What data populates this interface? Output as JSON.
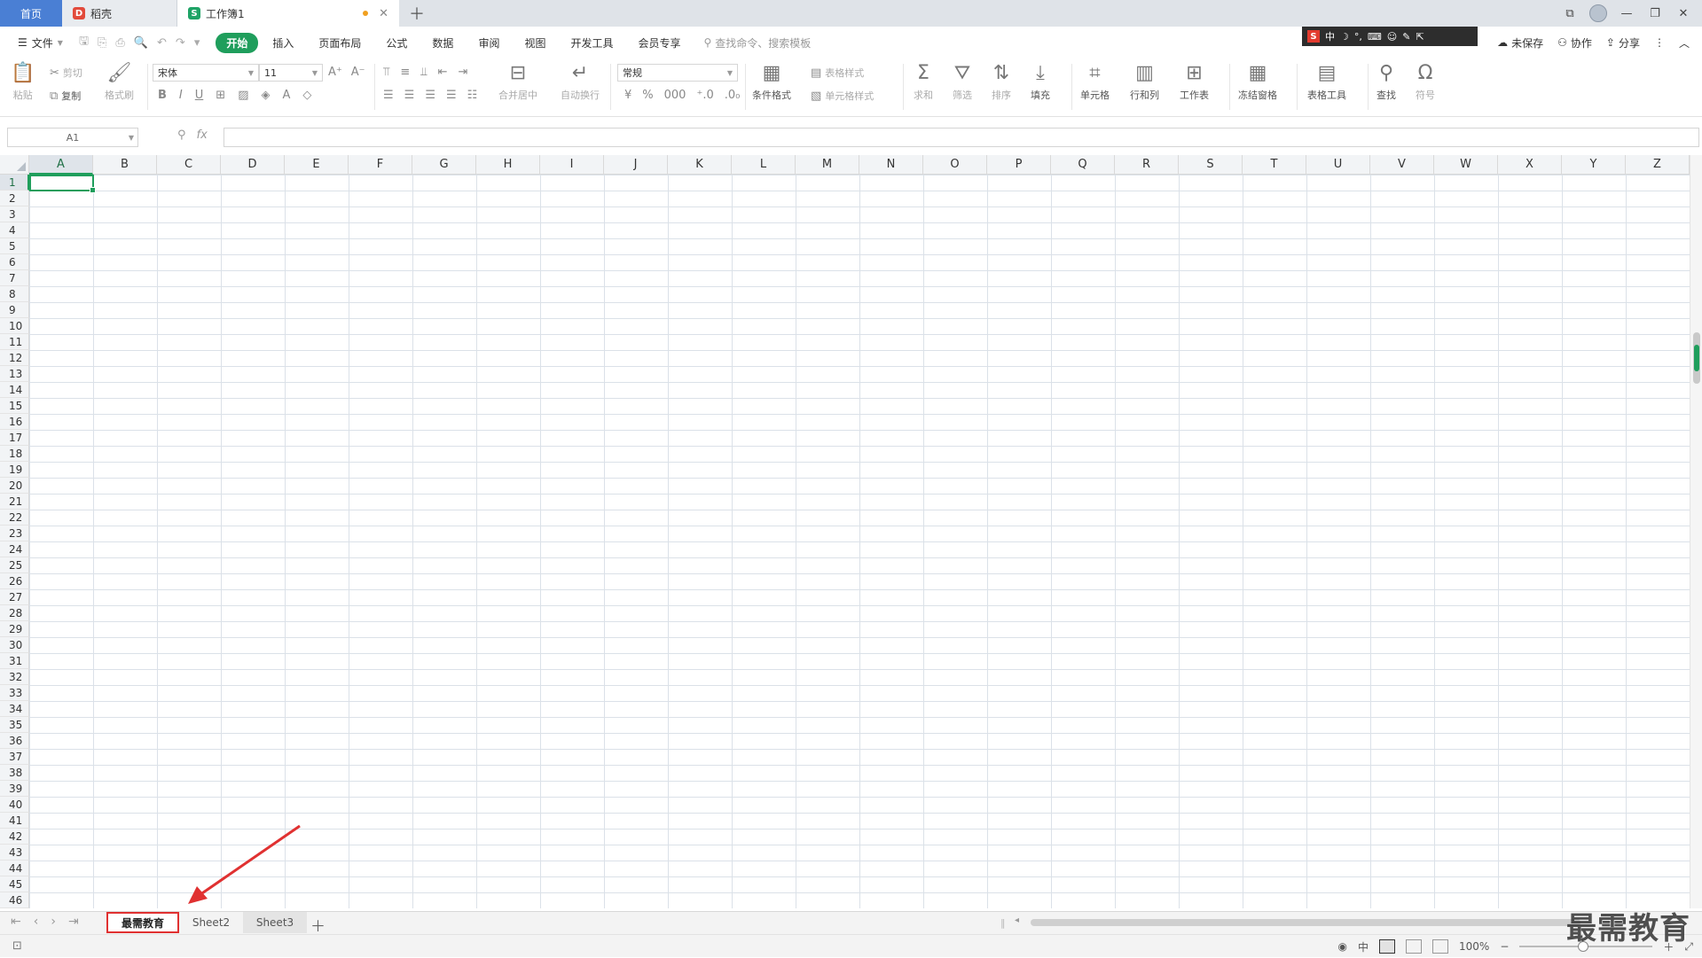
{
  "tabs": {
    "home": "首页",
    "shell": "稻壳",
    "book": "工作簿1"
  },
  "menu": {
    "file": "文件",
    "items": [
      "开始",
      "插入",
      "页面布局",
      "公式",
      "数据",
      "审阅",
      "视图",
      "开发工具",
      "会员专享"
    ],
    "active_index": 0,
    "search_placeholder": "查找命令、搜索模板",
    "right": [
      "未保存",
      "协作",
      "分享"
    ]
  },
  "ime": {
    "logo": "S",
    "mode": "中"
  },
  "ribbon": {
    "paste": "粘贴",
    "cut": "剪切",
    "copy": "复制",
    "format_painter": "格式刷",
    "font_name": "宋体",
    "font_size": "11",
    "merge_center": "合并居中",
    "wrap_text": "自动换行",
    "number_format": "常规",
    "conditional_format": "条件格式",
    "table_style": "表格样式",
    "cell_style": "单元格样式",
    "sum": "求和",
    "filter": "筛选",
    "sort": "排序",
    "fill": "填充",
    "cell": "单元格",
    "row_col": "行和列",
    "worksheet": "工作表",
    "freeze": "冻结窗格",
    "table_tools": "表格工具",
    "find": "查找",
    "symbol": "符号"
  },
  "formula_bar": {
    "name_box": "A1",
    "fx": "fx",
    "content": ""
  },
  "grid": {
    "columns": [
      "A",
      "B",
      "C",
      "D",
      "E",
      "F",
      "G",
      "H",
      "I",
      "J",
      "K",
      "L",
      "M",
      "N",
      "O",
      "P",
      "Q",
      "R",
      "S",
      "T",
      "U",
      "V",
      "W",
      "X",
      "Y",
      "Z"
    ],
    "rows_visible": 46,
    "active_cell": "A1"
  },
  "sheets": {
    "tabs": [
      "最需教育",
      "Sheet2",
      "Sheet3"
    ],
    "active_index": 0
  },
  "status": {
    "zoom": "100%"
  },
  "watermark": "最需教育",
  "colors": {
    "accent": "#1f9e5c",
    "annotation": "#e03131",
    "home_tab": "#4a7fd4"
  }
}
